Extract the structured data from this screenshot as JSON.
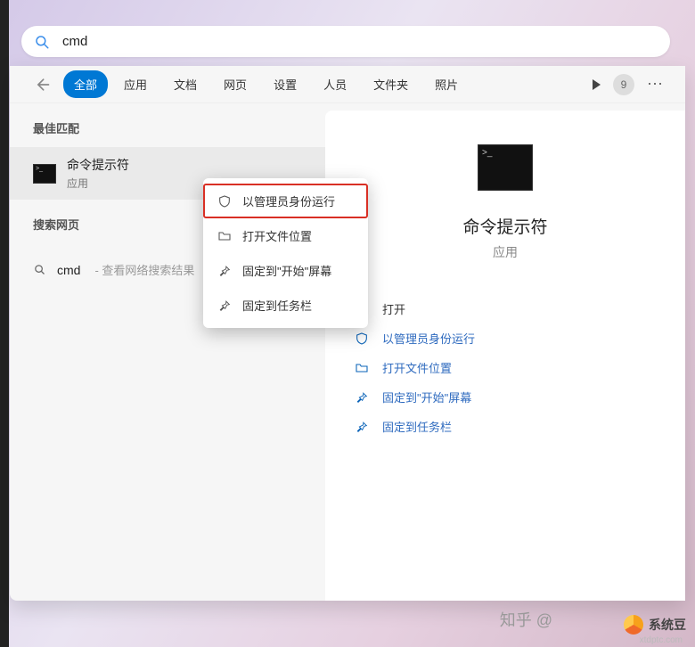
{
  "search": {
    "value": "cmd"
  },
  "tabs": [
    "全部",
    "应用",
    "文档",
    "网页",
    "设置",
    "人员",
    "文件夹",
    "照片"
  ],
  "badge": "9",
  "sections": {
    "best_match": "最佳匹配",
    "web": "搜索网页"
  },
  "best_match": {
    "title": "命令提示符",
    "subtitle": "应用"
  },
  "web_result": {
    "query": "cmd",
    "hint": " - 查看网络搜索结果"
  },
  "context_menu": [
    {
      "icon": "shield-icon",
      "label": "以管理员身份运行",
      "highlight": true
    },
    {
      "icon": "folder-open-icon",
      "label": "打开文件位置"
    },
    {
      "icon": "pin-icon",
      "label": "固定到\"开始\"屏幕"
    },
    {
      "icon": "pin-icon",
      "label": "固定到任务栏"
    }
  ],
  "details": {
    "name": "命令提示符",
    "type": "应用",
    "actions": [
      {
        "icon": "",
        "label": "打开",
        "key": "open"
      },
      {
        "icon": "shield-icon",
        "label": "以管理员身份运行",
        "key": "runas",
        "blue": true
      },
      {
        "icon": "folder-open-icon",
        "label": "打开文件位置",
        "key": "loc",
        "blue": true
      },
      {
        "icon": "pin-icon",
        "label": "固定到\"开始\"屏幕",
        "key": "pinstart",
        "blue": true
      },
      {
        "icon": "pin-icon",
        "label": "固定到任务栏",
        "key": "pintask",
        "blue": true
      }
    ]
  },
  "watermark": {
    "zhihu": "知乎 @",
    "brand": "系统豆",
    "url": "xtdptc.com"
  }
}
